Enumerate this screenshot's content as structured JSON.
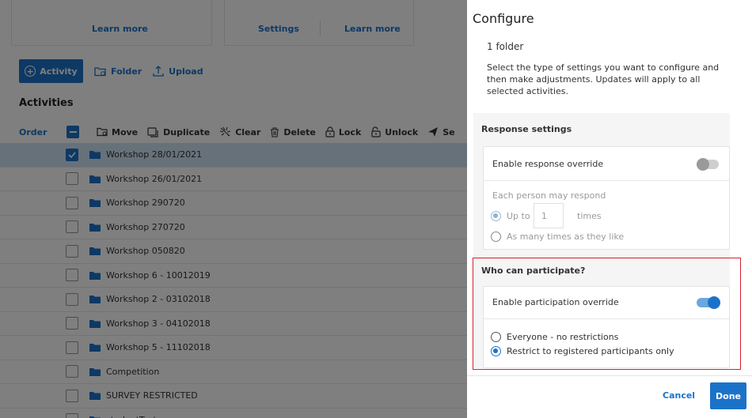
{
  "background": {
    "cards": {
      "card1_link": "Learn more",
      "card2_settings": "Settings",
      "card2_link": "Learn more"
    },
    "actions": {
      "activity": "Activity",
      "folder": "Folder",
      "upload": "Upload"
    },
    "heading": "Activities",
    "toolbar": {
      "order": "Order",
      "move": "Move",
      "duplicate": "Duplicate",
      "clear": "Clear",
      "delete": "Delete",
      "lock": "Lock",
      "unlock": "Unlock",
      "send": "Se"
    },
    "rows": [
      {
        "name": "Workshop 28/01/2021",
        "checked": true
      },
      {
        "name": "Workshop 26/01/2021",
        "checked": false
      },
      {
        "name": "Workshop 290720",
        "checked": false
      },
      {
        "name": "Workshop 270720",
        "checked": false
      },
      {
        "name": "Workshop 050820",
        "checked": false
      },
      {
        "name": "Workshop 6 - 10012019",
        "checked": false
      },
      {
        "name": "Workshop 2 - 03102018",
        "checked": false
      },
      {
        "name": "Workshop 3 - 04102018",
        "checked": false
      },
      {
        "name": "Workshop 5 - 11102018",
        "checked": false
      },
      {
        "name": "Competition",
        "checked": false
      },
      {
        "name": "SURVEY RESTRICTED",
        "checked": false
      },
      {
        "name": "studentTest",
        "checked": false
      }
    ]
  },
  "panel": {
    "title": "Configure",
    "subtitle": "1 folder",
    "description": "Select the type of settings you want to configure and then make adjustments. Updates will apply to all selected activities.",
    "response": {
      "heading": "Response settings",
      "override_label": "Enable response override",
      "override_on": false,
      "each_person": "Each person may respond",
      "up_to": "Up to",
      "times_value": "1",
      "times": "times",
      "as_many": "As many times as they like"
    },
    "participation": {
      "heading": "Who can participate?",
      "override_label": "Enable participation override",
      "override_on": true,
      "everyone": "Everyone - no restrictions",
      "restrict": "Restrict to registered participants only"
    },
    "cancel": "Cancel",
    "done": "Done"
  },
  "colors": {
    "accent": "#1b73c9",
    "highlight": "#d9222a"
  }
}
